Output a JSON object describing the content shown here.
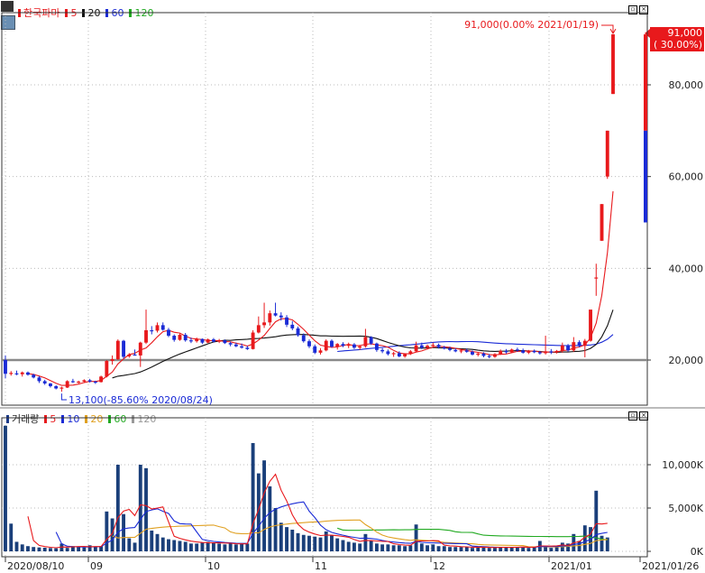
{
  "top_panel": {
    "stock_name": "한국파마",
    "ma_labels": [
      {
        "label": "5",
        "color": "#e8191c"
      },
      {
        "label": "20",
        "color": "#111111"
      },
      {
        "label": "60",
        "color": "#1a2bd6"
      },
      {
        "label": "120",
        "color": "#22aa22"
      }
    ],
    "max_annotation": "91,000(0.00% 2021/01/19)",
    "min_annotation": "13,100(-85.60% 2020/08/24)",
    "current_price": "91,000",
    "current_change": "( 30.00%)"
  },
  "bottom_panel": {
    "title": "거래량",
    "ma_labels": [
      {
        "label": "5",
        "color": "#e8191c"
      },
      {
        "label": "10",
        "color": "#1a2bd6"
      },
      {
        "label": "20",
        "color": "#e0a020"
      },
      {
        "label": "60",
        "color": "#22aa22"
      },
      {
        "label": "120",
        "color": "#999999"
      }
    ]
  },
  "chart_data": [
    {
      "type": "candlestick",
      "title": "한국파마",
      "y_ticks": [
        20000,
        40000,
        60000,
        80000
      ],
      "y_tick_labels": [
        "20,000",
        "40,000",
        "60,000",
        "80,000"
      ],
      "ylim": [
        8000,
        101000
      ],
      "reference_line": 20000,
      "x_labels": [
        "2020/08/10",
        "09",
        "10",
        "11",
        "12",
        "2021/01",
        "2021/01/26"
      ],
      "colors": {
        "up": "#e8191c",
        "down": "#1a2bd6"
      },
      "ohlc": [
        [
          20000,
          21000,
          16000,
          17000
        ],
        [
          17000,
          17600,
          16600,
          17200
        ],
        [
          17100,
          17700,
          16700,
          16900
        ],
        [
          16900,
          17500,
          16400,
          17300
        ],
        [
          17300,
          17500,
          16600,
          16800
        ],
        [
          16800,
          17000,
          16000,
          16200
        ],
        [
          16200,
          16500,
          15000,
          15400
        ],
        [
          15400,
          15700,
          14600,
          14900
        ],
        [
          14900,
          15000,
          14000,
          14300
        ],
        [
          14300,
          14500,
          13600,
          13800
        ],
        [
          13800,
          14200,
          13100,
          14000
        ],
        [
          14000,
          15600,
          13900,
          15400
        ],
        [
          15400,
          15900,
          15000,
          15200
        ],
        [
          15200,
          15500,
          14900,
          15300
        ],
        [
          15300,
          15800,
          15000,
          15600
        ],
        [
          15600,
          15900,
          15100,
          15300
        ],
        [
          15300,
          15500,
          14800,
          15200
        ],
        [
          15200,
          16600,
          15100,
          16400
        ],
        [
          16400,
          20000,
          16200,
          19800
        ],
        [
          19800,
          21000,
          19000,
          20200
        ],
        [
          20200,
          24500,
          20000,
          24200
        ],
        [
          24200,
          24400,
          20300,
          20700
        ],
        [
          20800,
          21500,
          20500,
          21200
        ],
        [
          21200,
          22300,
          21000,
          21000
        ],
        [
          21000,
          24000,
          18500,
          23800
        ],
        [
          23800,
          31000,
          23500,
          26500
        ],
        [
          26500,
          27400,
          25600,
          26400
        ],
        [
          26400,
          28200,
          26000,
          27600
        ],
        [
          27600,
          28200,
          26400,
          26600
        ],
        [
          26600,
          27000,
          25000,
          25300
        ],
        [
          25300,
          25600,
          24000,
          24400
        ],
        [
          24400,
          25800,
          24200,
          25500
        ],
        [
          25500,
          25900,
          24000,
          24300
        ],
        [
          24300,
          24900,
          23700,
          24100
        ],
        [
          24100,
          24900,
          23800,
          24600
        ],
        [
          24600,
          24700,
          23500,
          23800
        ],
        [
          23800,
          24700,
          23700,
          24500
        ],
        [
          24500,
          24800,
          23800,
          24000
        ],
        [
          24000,
          24600,
          23700,
          24300
        ],
        [
          24300,
          24500,
          23500,
          23700
        ],
        [
          23700,
          24000,
          23000,
          23400
        ],
        [
          23400,
          23800,
          22800,
          23000
        ],
        [
          23000,
          23600,
          22500,
          22700
        ],
        [
          22700,
          23100,
          22200,
          22400
        ],
        [
          22400,
          26500,
          22300,
          26000
        ],
        [
          26000,
          29500,
          25800,
          27600
        ],
        [
          27600,
          32500,
          27000,
          28200
        ],
        [
          28200,
          30800,
          27500,
          30200
        ],
        [
          30200,
          32500,
          29500,
          29700
        ],
        [
          29700,
          30400,
          28600,
          29300
        ],
        [
          29300,
          29800,
          27200,
          27700
        ],
        [
          27700,
          28500,
          26500,
          26900
        ],
        [
          26900,
          27300,
          25100,
          25400
        ],
        [
          25400,
          25800,
          23800,
          24100
        ],
        [
          24100,
          24500,
          22600,
          23000
        ],
        [
          23000,
          23400,
          21300,
          21600
        ],
        [
          21600,
          22600,
          21200,
          22100
        ],
        [
          22100,
          24500,
          21900,
          24200
        ],
        [
          24200,
          24500,
          22700,
          22900
        ],
        [
          22900,
          23700,
          22300,
          23500
        ],
        [
          23500,
          23900,
          22800,
          23100
        ],
        [
          23100,
          23800,
          22600,
          23400
        ],
        [
          23400,
          23700,
          22400,
          22700
        ],
        [
          22700,
          23300,
          22200,
          23000
        ],
        [
          23000,
          26800,
          22700,
          25000
        ],
        [
          25000,
          25200,
          23300,
          23600
        ],
        [
          23600,
          23800,
          21800,
          22200
        ],
        [
          22200,
          22600,
          21500,
          21900
        ],
        [
          21900,
          22300,
          21000,
          21300
        ],
        [
          21300,
          21800,
          20700,
          21500
        ],
        [
          21500,
          21900,
          20600,
          20800
        ],
        [
          20800,
          21500,
          20500,
          21300
        ],
        [
          21300,
          22200,
          21100,
          21900
        ],
        [
          21900,
          24000,
          21800,
          23200
        ],
        [
          23200,
          23800,
          22400,
          22700
        ],
        [
          22700,
          23400,
          22300,
          23100
        ],
        [
          23100,
          23800,
          22800,
          23300
        ],
        [
          23300,
          23600,
          22500,
          22800
        ],
        [
          22800,
          23100,
          22300,
          22500
        ],
        [
          22500,
          22900,
          21900,
          22200
        ],
        [
          22200,
          22600,
          21700,
          21900
        ],
        [
          21900,
          22400,
          21500,
          22100
        ],
        [
          22100,
          22500,
          21600,
          21800
        ],
        [
          21800,
          22100,
          21000,
          21200
        ],
        [
          21200,
          21700,
          20800,
          21400
        ],
        [
          21400,
          21700,
          20600,
          20900
        ],
        [
          20900,
          21300,
          20400,
          20700
        ],
        [
          20700,
          21500,
          20500,
          21300
        ],
        [
          21300,
          22300,
          21100,
          22000
        ],
        [
          22000,
          22400,
          21400,
          21700
        ],
        [
          21700,
          22500,
          21500,
          22300
        ],
        [
          22300,
          22700,
          21800,
          22100
        ],
        [
          22100,
          22500,
          21400,
          21600
        ],
        [
          21600,
          22200,
          21300,
          22000
        ],
        [
          22000,
          22300,
          21500,
          21700
        ],
        [
          21700,
          22000,
          21200,
          21500
        ],
        [
          21500,
          25300,
          21200,
          21900
        ],
        [
          21900,
          22400,
          21300,
          21700
        ],
        [
          21700,
          22200,
          21400,
          22000
        ],
        [
          22000,
          23800,
          21600,
          23200
        ],
        [
          23200,
          23500,
          21800,
          22100
        ],
        [
          22100,
          25000,
          21800,
          23900
        ],
        [
          23900,
          24300,
          22800,
          23100
        ],
        [
          23100,
          24600,
          20600,
          24200
        ],
        [
          24200,
          29000,
          24000,
          31000
        ],
        [
          38000,
          41000,
          34000,
          38000
        ],
        [
          46000,
          54000,
          46000,
          54000
        ],
        [
          60000,
          70000,
          59500,
          70000
        ],
        [
          78000,
          91000,
          78000,
          91000
        ]
      ]
    },
    {
      "type": "bar",
      "title": "거래량",
      "y_ticks": [
        0,
        5000,
        10000
      ],
      "y_tick_labels": [
        "0K",
        "5,000K",
        "10,000K"
      ],
      "ylim": [
        0,
        15000
      ],
      "volume": [
        14500,
        3200,
        1100,
        800,
        600,
        500,
        450,
        420,
        380,
        350,
        900,
        400,
        600,
        500,
        450,
        700,
        500,
        600,
        4600,
        3800,
        10000,
        4300,
        1500,
        1000,
        10000,
        9600,
        2400,
        2000,
        1600,
        1400,
        1300,
        1200,
        1100,
        900,
        900,
        1000,
        1100,
        1000,
        900,
        800,
        900,
        800,
        900,
        900,
        12500,
        9000,
        10500,
        7500,
        5000,
        3300,
        2800,
        2500,
        2100,
        1900,
        1800,
        1700,
        1600,
        2300,
        1900,
        1500,
        1300,
        1100,
        1000,
        900,
        2000,
        1200,
        900,
        800,
        800,
        700,
        700,
        600,
        700,
        3100,
        900,
        700,
        800,
        600,
        600,
        500,
        500,
        500,
        500,
        400,
        500,
        500,
        400,
        400,
        500,
        500,
        500,
        500,
        500,
        400,
        500,
        1200,
        500,
        400,
        600,
        1000,
        900,
        2000,
        1200,
        3000,
        2800,
        7000,
        1800,
        1600
      ]
    }
  ]
}
